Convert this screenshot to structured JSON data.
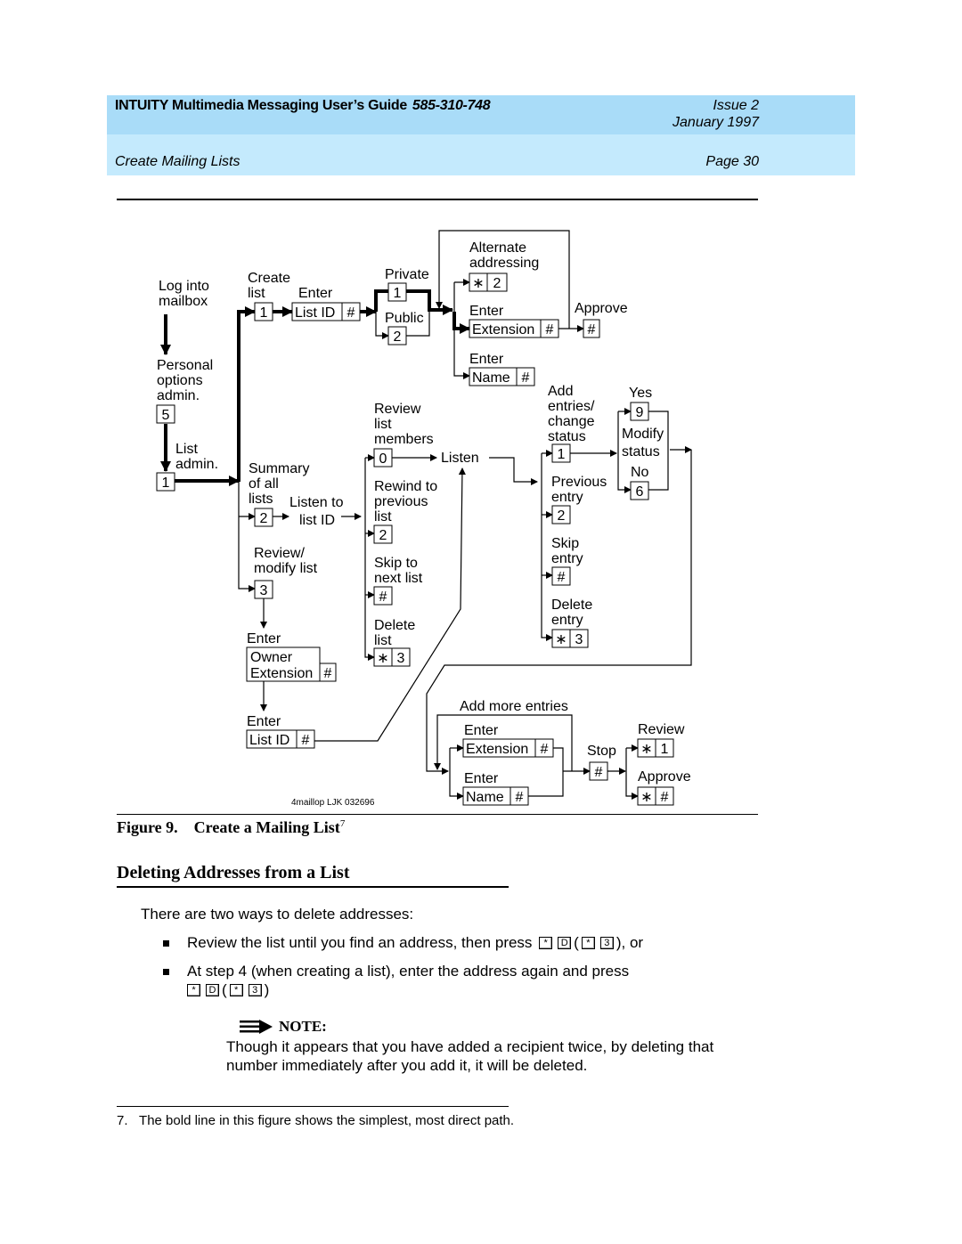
{
  "header": {
    "guide_title": "INTUITY Multimedia Messaging User’s Guide",
    "doc_number": "585-310-748",
    "issue": "Issue 2",
    "date": "January 1997",
    "section": "Create Mailing Lists",
    "page": "Page 30",
    "colors": {
      "band_top": "#a9dcf8",
      "band_bottom": "#c4eafd"
    }
  },
  "diagram": {
    "credit": "4maillop LJK 032696",
    "labels": [
      {
        "id": "log-into-mailbox",
        "lines": [
          "Log into",
          "mailbox"
        ]
      },
      {
        "id": "personal-options",
        "lines": [
          "Personal",
          "options",
          "admin."
        ]
      },
      {
        "id": "list-admin",
        "lines": [
          "List",
          "admin."
        ]
      },
      {
        "id": "create-list",
        "lines": [
          "Create",
          "list"
        ]
      },
      {
        "id": "enter-list-id",
        "lines": [
          "Enter"
        ]
      },
      {
        "id": "private",
        "lines": [
          "Private"
        ]
      },
      {
        "id": "public",
        "lines": [
          "Public"
        ]
      },
      {
        "id": "alternate-addressing",
        "lines": [
          "Alternate",
          "addressing"
        ]
      },
      {
        "id": "enter-extension",
        "lines": [
          "Enter"
        ]
      },
      {
        "id": "approve-top",
        "lines": [
          "Approve"
        ]
      },
      {
        "id": "enter-name",
        "lines": [
          "Enter"
        ]
      },
      {
        "id": "summary",
        "lines": [
          "Summary",
          "of all",
          "lists"
        ]
      },
      {
        "id": "listen-to",
        "lines": [
          "Listen to"
        ]
      },
      {
        "id": "list-id",
        "lines": [
          "list ID"
        ]
      },
      {
        "id": "review-modify",
        "lines": [
          "Review/",
          "modify list"
        ]
      },
      {
        "id": "enter-owner",
        "lines": [
          "Enter"
        ]
      },
      {
        "id": "enter-list-id-2",
        "lines": [
          "Enter"
        ]
      },
      {
        "id": "review-members",
        "lines": [
          "Review",
          "list",
          "members"
        ]
      },
      {
        "id": "listen",
        "lines": [
          "Listen"
        ]
      },
      {
        "id": "rewind",
        "lines": [
          "Rewind to",
          "previous",
          "list"
        ]
      },
      {
        "id": "skip-next",
        "lines": [
          "Skip to",
          "next list"
        ]
      },
      {
        "id": "delete-list",
        "lines": [
          "Delete",
          "list"
        ]
      },
      {
        "id": "add-entries",
        "lines": [
          "Add",
          "entries/",
          "change",
          "status"
        ]
      },
      {
        "id": "previous-entry",
        "lines": [
          "Previous",
          "entry"
        ]
      },
      {
        "id": "skip-entry",
        "lines": [
          "Skip",
          "entry"
        ]
      },
      {
        "id": "delete-entry",
        "lines": [
          "Delete",
          "entry"
        ]
      },
      {
        "id": "yes",
        "lines": [
          "Yes"
        ]
      },
      {
        "id": "modify-status",
        "lines": [
          "Modify",
          "status"
        ]
      },
      {
        "id": "no",
        "lines": [
          "No"
        ]
      },
      {
        "id": "add-more",
        "lines": [
          "Add more entries"
        ]
      },
      {
        "id": "enter-ext-2",
        "lines": [
          "Enter"
        ]
      },
      {
        "id": "enter-name-2",
        "lines": [
          "Enter"
        ]
      },
      {
        "id": "stop",
        "lines": [
          "Stop"
        ]
      },
      {
        "id": "review-bottom",
        "lines": [
          "Review"
        ]
      },
      {
        "id": "approve-bottom",
        "lines": [
          "Approve"
        ]
      }
    ],
    "keys": [
      {
        "id": "k5",
        "cells": [
          "5"
        ]
      },
      {
        "id": "k1-admin",
        "cells": [
          "1"
        ]
      },
      {
        "id": "k1-create",
        "cells": [
          "1"
        ]
      },
      {
        "id": "k-listid",
        "cells": [
          "List ID",
          "#"
        ]
      },
      {
        "id": "k1-private",
        "cells": [
          "1"
        ]
      },
      {
        "id": "k2-public",
        "cells": [
          "2"
        ]
      },
      {
        "id": "k-star2",
        "cells": [
          "∗",
          "2"
        ]
      },
      {
        "id": "k-extension",
        "cells": [
          "Extension",
          "#"
        ]
      },
      {
        "id": "k-approve",
        "cells": [
          "#"
        ]
      },
      {
        "id": "k-name",
        "cells": [
          "Name",
          "#"
        ]
      },
      {
        "id": "k2-summary",
        "cells": [
          "2"
        ]
      },
      {
        "id": "k3-review",
        "cells": [
          "3"
        ]
      },
      {
        "id": "k-owner",
        "cells": [
          "Owner",
          "Extension",
          "#"
        ]
      },
      {
        "id": "k-listid-2",
        "cells": [
          "List ID",
          "#"
        ]
      },
      {
        "id": "k0",
        "cells": [
          "0"
        ]
      },
      {
        "id": "k2-rewind",
        "cells": [
          "2"
        ]
      },
      {
        "id": "k-skip",
        "cells": [
          "#"
        ]
      },
      {
        "id": "k-star3-list",
        "cells": [
          "∗",
          "3"
        ]
      },
      {
        "id": "k1-add",
        "cells": [
          "1"
        ]
      },
      {
        "id": "k2-prev",
        "cells": [
          "2"
        ]
      },
      {
        "id": "k-skip-entry",
        "cells": [
          "#"
        ]
      },
      {
        "id": "k-star3-entry",
        "cells": [
          "∗",
          "3"
        ]
      },
      {
        "id": "k9",
        "cells": [
          "9"
        ]
      },
      {
        "id": "k6",
        "cells": [
          "6"
        ]
      },
      {
        "id": "k-extension-2",
        "cells": [
          "Extension",
          "#"
        ]
      },
      {
        "id": "k-name-2",
        "cells": [
          "Name",
          "#"
        ]
      },
      {
        "id": "k-stop",
        "cells": [
          "#"
        ]
      },
      {
        "id": "k-star1",
        "cells": [
          "∗",
          "1"
        ]
      },
      {
        "id": "k-star-hash",
        "cells": [
          "∗",
          "#"
        ]
      }
    ]
  },
  "figure": {
    "caption": "Figure 9.    Create a Mailing List",
    "footnote_ref": "7"
  },
  "section": {
    "heading": "Deleting Addresses from a List",
    "intro": "There are two ways to delete addresses:",
    "bullets": [
      {
        "text": "Review the list until you find an address, then press",
        "keys": [
          "*",
          "D",
          "*",
          "3"
        ],
        "tail": ", or"
      },
      {
        "text": "At step 4 (when creating a list), enter the address again and press",
        "keys": [
          "*",
          "D",
          "*",
          "3"
        ],
        "tail": ""
      }
    ],
    "note_label": "NOTE:",
    "note_lines": [
      "Though it appears that you have added a recipient twice, by deleting that",
      "number immediately after you add it, it will be deleted."
    ]
  },
  "footnote": {
    "number": "7.",
    "text": "The bold line in this figure shows the simplest, most direct path."
  }
}
